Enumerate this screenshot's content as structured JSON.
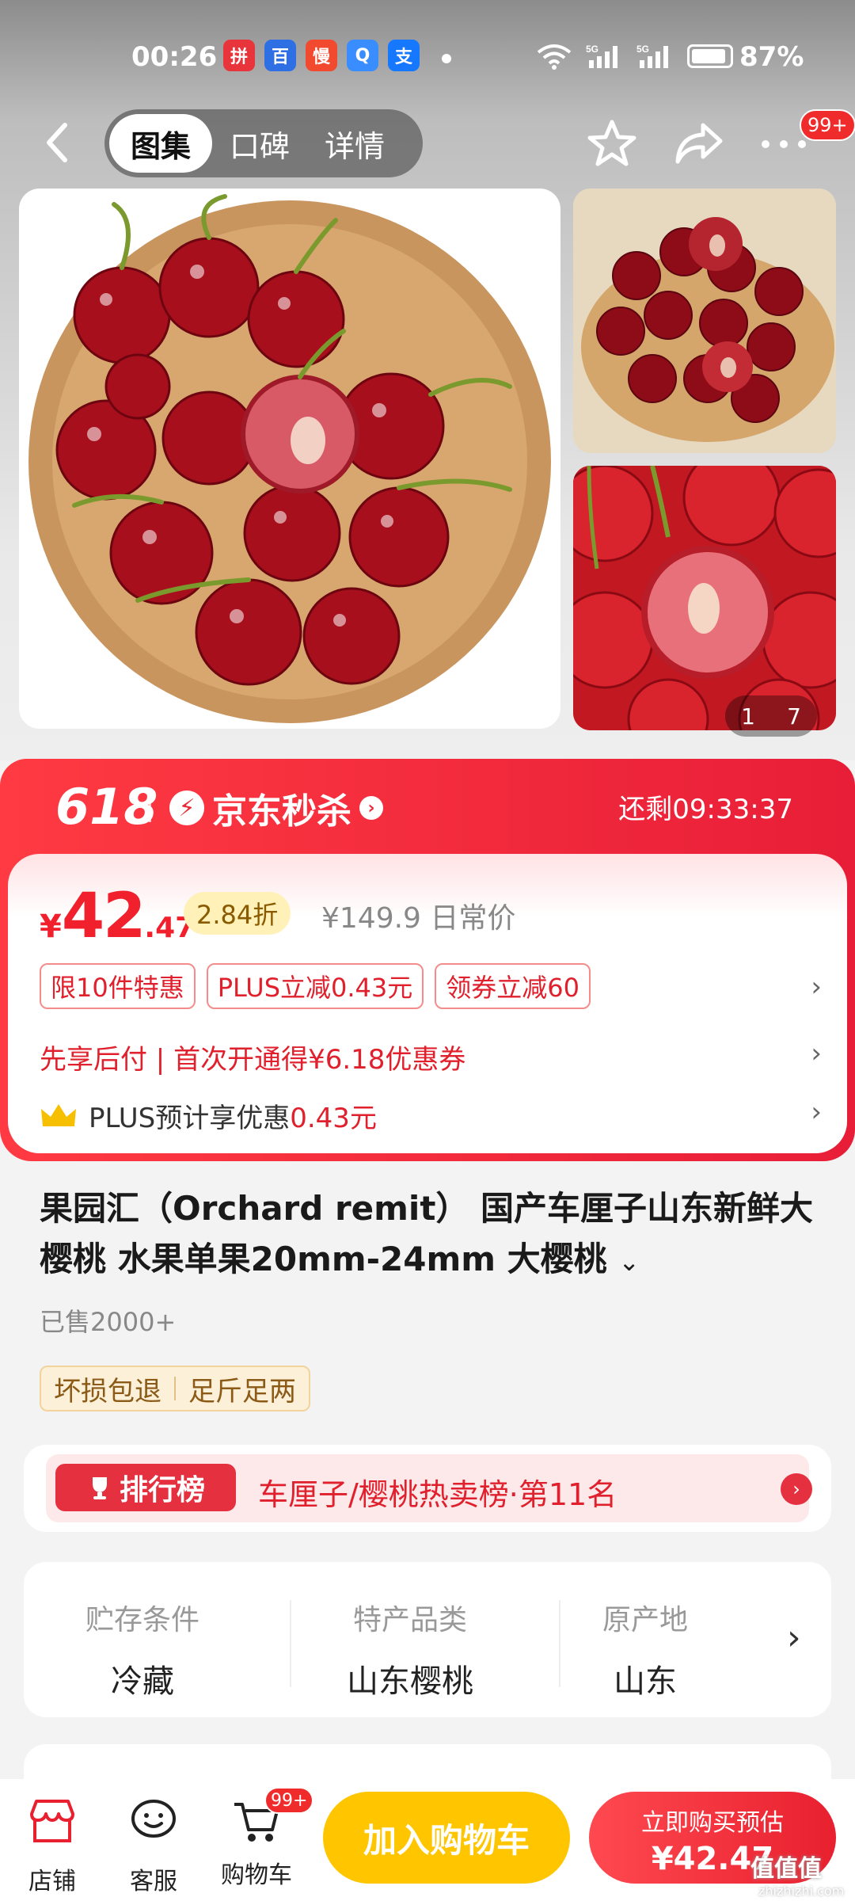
{
  "status_bar": {
    "time": "00:26",
    "battery": "87%",
    "app_icons": [
      "拼",
      "百",
      "慢",
      "Q",
      "支"
    ]
  },
  "nav": {
    "tabs": [
      "图集",
      "口碑",
      "详情"
    ],
    "more_badge": "99+"
  },
  "gallery": {
    "current": "1",
    "total": "7"
  },
  "promo": {
    "event": "618",
    "channel": "京东秒杀",
    "countdown": "还剩09:33:37",
    "price_symbol": "¥",
    "price_int": "42",
    "price_dec": ".47",
    "discount": "2.84折",
    "original_price": "¥149.9 日常价",
    "chips": [
      "限10件特惠",
      "PLUS立减0.43元",
      "领券立减60"
    ],
    "pay_later": "先享后付 | 首次开通得¥6.18优惠券",
    "plus_prefix": "PLUS预计享优惠",
    "plus_amount": "0.43元"
  },
  "product": {
    "title": "果园汇（Orchard remit） 国产车厘子山东新鲜大樱桃  水果单果20mm-24mm 大樱桃",
    "sold": "已售2000+",
    "tags": [
      "坏损包退",
      "足斤足两"
    ]
  },
  "rank": {
    "badge": "排行榜",
    "text": "车厘子/樱桃热卖榜·第11名"
  },
  "attributes": [
    {
      "key": "贮存条件",
      "value": "冷藏"
    },
    {
      "key": "特产品类",
      "value": "山东樱桃"
    },
    {
      "key": "原产地",
      "value": "山东"
    }
  ],
  "bottom": {
    "store": "店铺",
    "service": "客服",
    "cart": "购物车",
    "cart_badge": "99+",
    "add_cart": "加入购物车",
    "buy_now_line1": "立即购买预估",
    "buy_now_line2": "¥42.47"
  },
  "watermark": {
    "text": "值值值",
    "sub": "zhizhizhi.com"
  }
}
